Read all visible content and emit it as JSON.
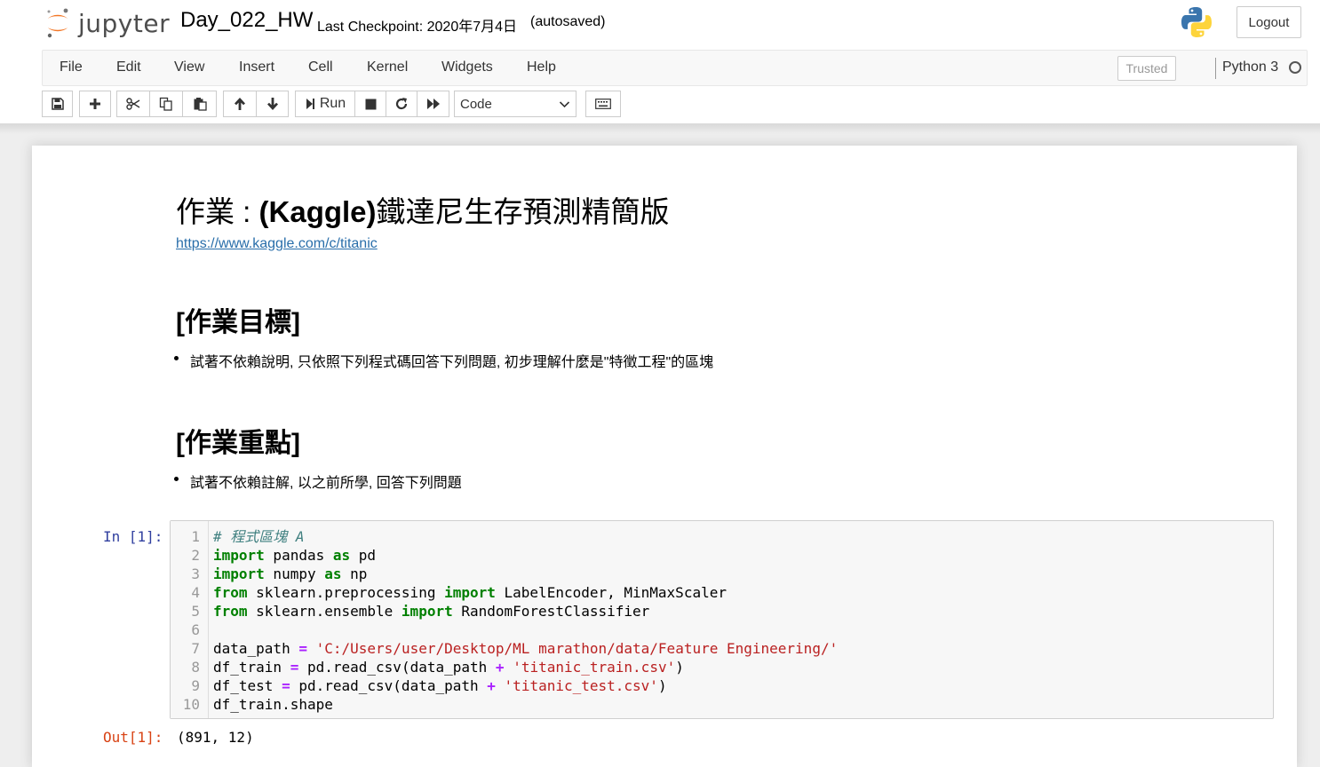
{
  "header": {
    "logo_text": "jupyter",
    "notebook_title": "Day_022_HW",
    "checkpoint": "Last Checkpoint: 2020年7月4日",
    "autosave_status": "(autosaved)",
    "logout_label": "Logout"
  },
  "menu": {
    "items": [
      "File",
      "Edit",
      "View",
      "Insert",
      "Cell",
      "Kernel",
      "Widgets",
      "Help"
    ],
    "trusted_label": "Trusted",
    "kernel_name": "Python 3"
  },
  "toolbar": {
    "run_label": "Run",
    "cell_type": "Code",
    "icons": [
      "save-icon",
      "plus-icon",
      "cut-icon",
      "copy-icon",
      "paste-icon",
      "arrow-up-icon",
      "arrow-down-icon",
      "run-icon",
      "stop-icon",
      "restart-icon",
      "fast-forward-icon",
      "chevron-down-icon",
      "keyboard-icon"
    ]
  },
  "notebook": {
    "title_prefix": "作業 : ",
    "title_bold": "(Kaggle)",
    "title_suffix": "鐵達尼生存預測精簡版",
    "link": "https://www.kaggle.com/c/titanic",
    "section1_heading": "[作業目標]",
    "section1_bullet": "試著不依賴說明, 只依照下列程式碼回答下列問題, 初步理解什麼是\"特徵工程\"的區塊",
    "section2_heading": "[作業重點]",
    "section2_bullet": "試著不依賴註解, 以之前所學, 回答下列問題",
    "cell": {
      "in_prompt": "In [1]:",
      "out_prompt": "Out[1]:",
      "output": "(891, 12)",
      "lines": [
        "1",
        "2",
        "3",
        "4",
        "5",
        "6",
        "7",
        "8",
        "9",
        "10"
      ],
      "code": {
        "l1_comment": "# 程式區塊 A",
        "l2_kw1": "import",
        "l2_mod": " pandas ",
        "l2_kw2": "as",
        "l2_alias": " pd",
        "l3_kw1": "import",
        "l3_mod": " numpy ",
        "l3_kw2": "as",
        "l3_alias": " np",
        "l4_kw1": "from",
        "l4_mod": " sklearn.preprocessing ",
        "l4_kw2": "import",
        "l4_rest": " LabelEncoder, MinMaxScaler",
        "l5_kw1": "from",
        "l5_mod": " sklearn.ensemble ",
        "l5_kw2": "import",
        "l5_rest": " RandomForestClassifier",
        "l7_var": "data_path ",
        "l7_op": "=",
        "l7_sp": " ",
        "l7_str": "'C:/Users/user/Desktop/ML marathon/data/Feature Engineering/'",
        "l8_var": "df_train ",
        "l8_op": "=",
        "l8_call": " pd.read_csv(data_path ",
        "l8_plus": "+",
        "l8_sp": " ",
        "l8_str": "'titanic_train.csv'",
        "l8_end": ")",
        "l9_var": "df_test ",
        "l9_op": "=",
        "l9_call": " pd.read_csv(data_path ",
        "l9_plus": "+",
        "l9_sp": " ",
        "l9_str": "'titanic_test.csv'",
        "l9_end": ")",
        "l10": "df_train.shape"
      }
    }
  }
}
